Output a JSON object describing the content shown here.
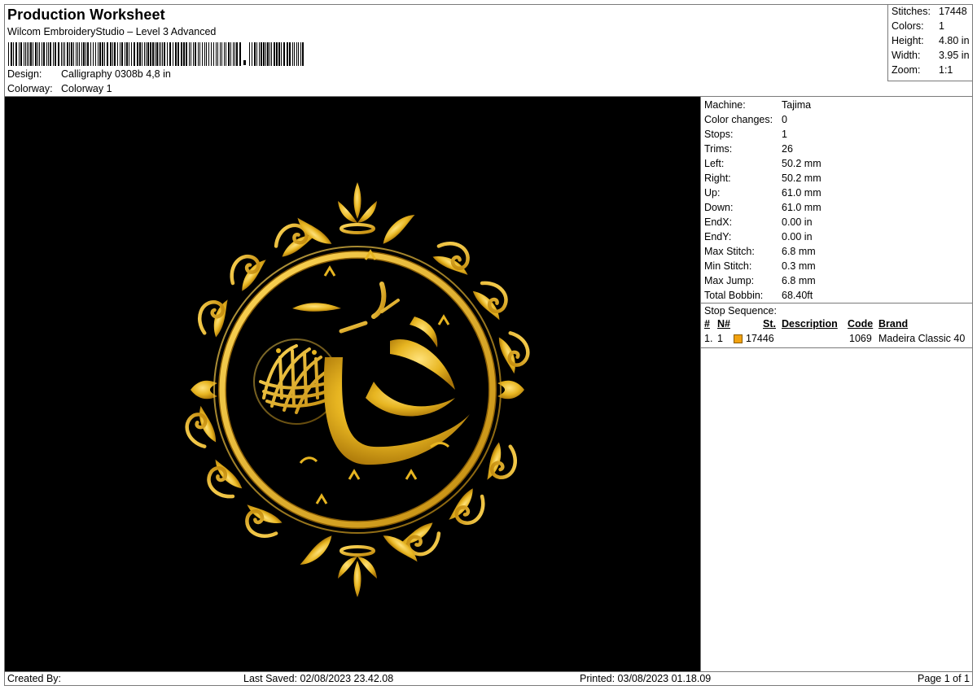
{
  "worksheet": {
    "title": "Production Worksheet",
    "software": "Wilcom EmbroideryStudio – Level 3 Advanced",
    "design_label": "Design:",
    "design_value": "Calligraphy 0308b 4,8 in",
    "colorway_label": "Colorway:",
    "colorway_value": "Colorway 1"
  },
  "summary": [
    {
      "label": "Stitches:",
      "value": "17448"
    },
    {
      "label": "Colors:",
      "value": "1"
    },
    {
      "label": "Height:",
      "value": "4.80 in"
    },
    {
      "label": "Width:",
      "value": "3.95 in"
    },
    {
      "label": "Zoom:",
      "value": "1:1"
    }
  ],
  "machine_info": [
    {
      "label": "Machine:",
      "value": "Tajima"
    },
    {
      "label": "Color changes:",
      "value": "0"
    },
    {
      "label": "Stops:",
      "value": "1"
    },
    {
      "label": "Trims:",
      "value": "26"
    },
    {
      "label": "Left:",
      "value": "50.2 mm"
    },
    {
      "label": "Right:",
      "value": "50.2 mm"
    },
    {
      "label": "Up:",
      "value": "61.0 mm"
    },
    {
      "label": "Down:",
      "value": "61.0 mm"
    },
    {
      "label": "EndX:",
      "value": "0.00 in"
    },
    {
      "label": "EndY:",
      "value": "0.00 in"
    },
    {
      "label": "Max Stitch:",
      "value": "6.8 mm"
    },
    {
      "label": "Min Stitch:",
      "value": "0.3 mm"
    },
    {
      "label": "Max Jump:",
      "value": "6.8 mm"
    },
    {
      "label": "Total Bobbin:",
      "value": "68.40ft"
    }
  ],
  "stop_sequence": {
    "title": "Stop Sequence:",
    "headers": {
      "num": "#",
      "n": "N#",
      "st": "St.",
      "description": "Description",
      "code": "Code",
      "brand": "Brand"
    },
    "rows": [
      {
        "num": "1.",
        "n": "1",
        "st": "17446",
        "description": "",
        "code": "1069",
        "brand": "Madeira Classic 40",
        "color": "#f2a20f"
      }
    ]
  },
  "footer": {
    "created_by": "Created By:",
    "last_saved": "Last Saved: 02/08/2023 23.42.08",
    "printed": "Printed: 03/08/2023 01.18.09",
    "page": "Page 1 of 1"
  },
  "colors": {
    "thread": "#f2a20f",
    "gold": "#e7b521",
    "background": "#000000"
  }
}
